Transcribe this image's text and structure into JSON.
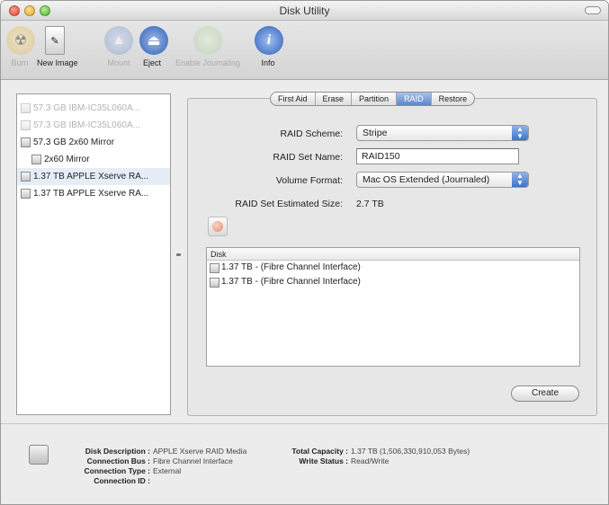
{
  "window": {
    "title": "Disk Utility"
  },
  "toolbar": {
    "burn": "Burn",
    "new_image": "New Image",
    "mount": "Mount",
    "eject": "Eject",
    "enable_journaling": "Enable Journaling",
    "info": "Info"
  },
  "sidebar": {
    "items": [
      {
        "label": "57.3 GB IBM-IC35L060A..."
      },
      {
        "label": "57.3 GB IBM-IC35L060A..."
      },
      {
        "label": "57.3 GB 2x60 Mirror"
      },
      {
        "label": "2x60 Mirror"
      },
      {
        "label": "1.37 TB APPLE Xserve RA..."
      },
      {
        "label": "1.37 TB APPLE Xserve RA..."
      }
    ]
  },
  "tabs": [
    "First Aid",
    "Erase",
    "Partition",
    "RAID",
    "Restore"
  ],
  "raid": {
    "scheme_label": "RAID Scheme:",
    "scheme_value": "Stripe",
    "set_name_label": "RAID Set Name:",
    "set_name_value": "RAID150",
    "volume_format_label": "Volume Format:",
    "volume_format_value": "Mac OS Extended (Journaled)",
    "estimated_size_label": "RAID Set Estimated Size:",
    "estimated_size_value": "2.7 TB",
    "table_header": "Disk",
    "disks": [
      "1.37 TB - (Fibre Channel Interface)",
      "1.37 TB - (Fibre Channel Interface)"
    ],
    "create_button": "Create"
  },
  "info": {
    "disk_description_label": "Disk Description :",
    "disk_description_value": "APPLE Xserve RAID Media",
    "connection_bus_label": "Connection Bus :",
    "connection_bus_value": "Fibre Channel Interface",
    "connection_type_label": "Connection Type :",
    "connection_type_value": "External",
    "connection_id_label": "Connection ID :",
    "connection_id_value": "",
    "total_capacity_label": "Total Capacity :",
    "total_capacity_value": "1.37 TB (1,506,330,910,053 Bytes)",
    "write_status_label": "Write Status :",
    "write_status_value": "Read/Write"
  }
}
